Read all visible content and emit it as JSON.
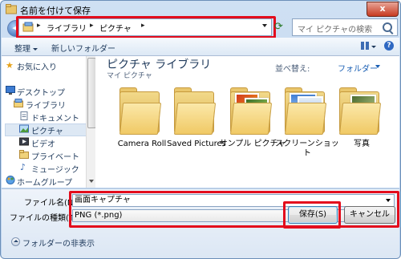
{
  "window": {
    "title": "名前を付けて保存",
    "close_label": "x"
  },
  "address": {
    "segments": [
      "ライブラリ",
      "ピクチャ"
    ]
  },
  "search": {
    "placeholder": "マイ ピクチャの検索"
  },
  "toolbar": {
    "organize": "整理",
    "new_folder": "新しいフォルダー"
  },
  "nav": {
    "items": [
      {
        "label": "お気に入り",
        "icon": "star-icon"
      },
      {
        "label": "デスクトップ",
        "icon": "desktop-icon"
      },
      {
        "label": "ライブラリ",
        "icon": "library-icon"
      },
      {
        "label": "ドキュメント",
        "icon": "document-icon"
      },
      {
        "label": "ピクチャ",
        "icon": "picture-icon"
      },
      {
        "label": "ビデオ",
        "icon": "video-icon"
      },
      {
        "label": "プライベート",
        "icon": "folder-icon"
      },
      {
        "label": "ミュージック",
        "icon": "music-icon"
      },
      {
        "label": "ホームグループ",
        "icon": "homegroup-icon"
      }
    ]
  },
  "content": {
    "library_title": "ピクチャ ライブラリ",
    "library_subtitle": "マイ ピクチャ",
    "arrange_label": "並べ替え:",
    "arrange_value": "フォルダー",
    "folders": [
      {
        "name": "Camera Roll"
      },
      {
        "name": "Saved Pictures"
      },
      {
        "name": "サンプル ピクチャ"
      },
      {
        "name": "スクリーンショット"
      },
      {
        "name": "写真"
      }
    ]
  },
  "form": {
    "filename_label": "ファイル名(N):",
    "filename_value": "画面キャプチャ",
    "filetype_label": "ファイルの種類(T):",
    "filetype_value": "PNG (*.png)",
    "hide_folders": "フォルダーの非表示",
    "save_label": "保存(S)",
    "cancel_label": "キャンセル"
  },
  "colors": {
    "highlight": "#e30c1c",
    "accent": "#1a5fb4"
  }
}
